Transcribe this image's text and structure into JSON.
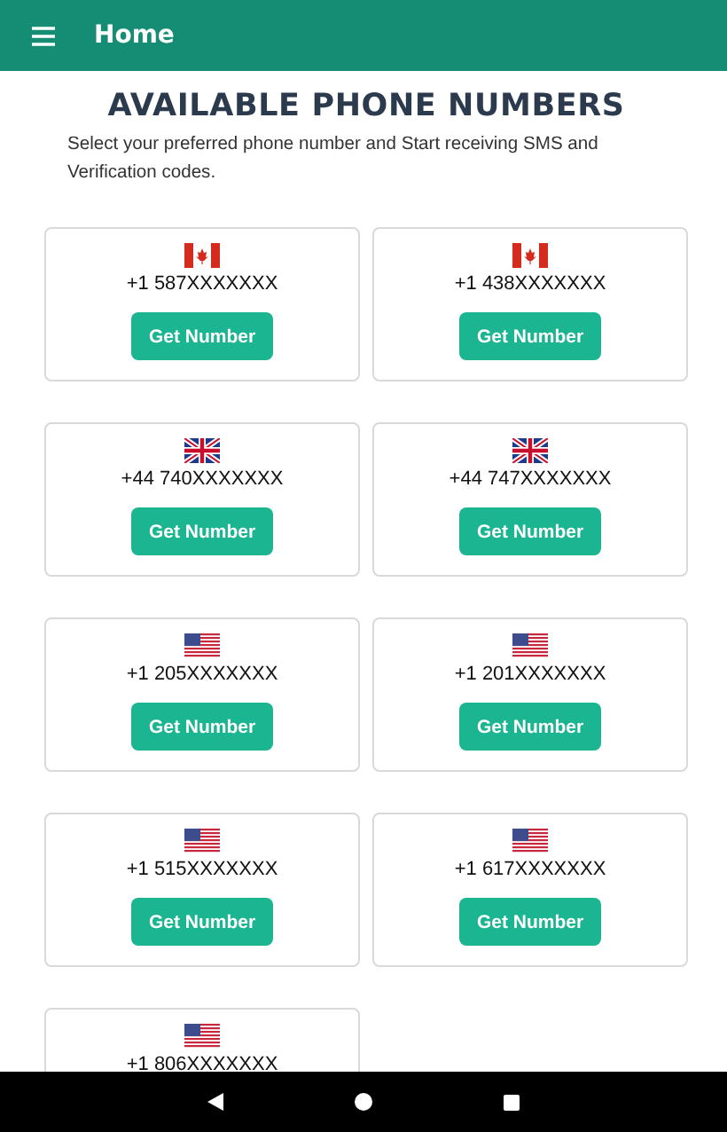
{
  "app_bar": {
    "title": "Home"
  },
  "heading": "AVAILABLE PHONE NUMBERS",
  "subtitle": "Select your preferred phone number and Start receiving SMS and Verification codes.",
  "numbers": [
    {
      "kind": "ca",
      "number": "+1 587XXXXXXX",
      "button": "Get Number"
    },
    {
      "kind": "ca",
      "number": "+1 438XXXXXXX",
      "button": "Get Number"
    },
    {
      "kind": "gb",
      "number": "+44 740XXXXXXX",
      "button": "Get Number"
    },
    {
      "kind": "gb",
      "number": "+44 747XXXXXXX",
      "button": "Get Number"
    },
    {
      "kind": "us",
      "number": "+1 205XXXXXXX",
      "button": "Get Number"
    },
    {
      "kind": "us",
      "number": "+1 201XXXXXXX",
      "button": "Get Number"
    },
    {
      "kind": "us",
      "number": "+1 515XXXXXXX",
      "button": "Get Number"
    },
    {
      "kind": "us",
      "number": "+1 617XXXXXXX",
      "button": "Get Number"
    },
    {
      "kind": "us",
      "number": "+1 806XXXXXXX"
    }
  ]
}
